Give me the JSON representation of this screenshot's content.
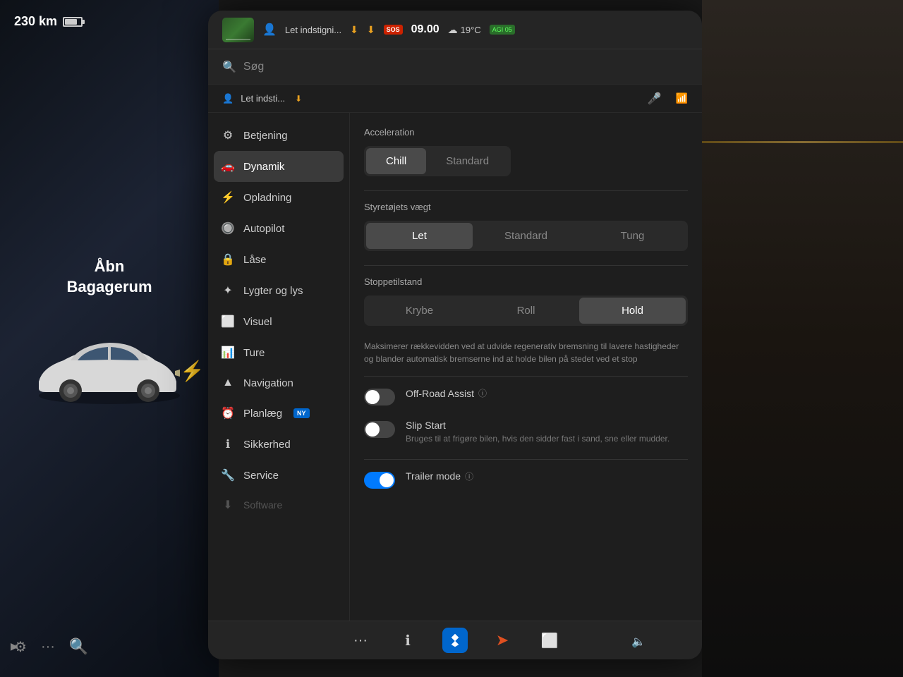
{
  "km_display": {
    "value": "230 km"
  },
  "status_bar": {
    "person_label": "Let indstigni...",
    "time": "09.00",
    "temperature": "19°C",
    "sos_label": "SOS",
    "aqi_label": "AGI 05"
  },
  "secondary_bar": {
    "person_label": "Let indsti...",
    "arrow_label": "▼",
    "mic_label": "🎤"
  },
  "search": {
    "placeholder": "Søg"
  },
  "sidebar": {
    "items": [
      {
        "id": "betjening",
        "label": "Betjening",
        "icon": "⚙"
      },
      {
        "id": "dynamik",
        "label": "Dynamik",
        "icon": "🚗",
        "active": true
      },
      {
        "id": "opladning",
        "label": "Opladning",
        "icon": "⚡"
      },
      {
        "id": "autopilot",
        "label": "Autopilot",
        "icon": "🔘"
      },
      {
        "id": "laase",
        "label": "Låse",
        "icon": "🔒"
      },
      {
        "id": "lygter",
        "label": "Lygter og lys",
        "icon": "✦"
      },
      {
        "id": "visuel",
        "label": "Visuel",
        "icon": "⬜"
      },
      {
        "id": "ture",
        "label": "Ture",
        "icon": "📊"
      },
      {
        "id": "navigation",
        "label": "Navigation",
        "icon": "▲"
      },
      {
        "id": "planlaeg",
        "label": "Planlæg",
        "icon": "⏰",
        "badge": "NY"
      },
      {
        "id": "sikkerhed",
        "label": "Sikkerhed",
        "icon": "ℹ"
      },
      {
        "id": "service",
        "label": "Service",
        "icon": "🔧"
      },
      {
        "id": "software",
        "label": "Software",
        "icon": "⬇"
      }
    ]
  },
  "settings": {
    "acceleration": {
      "label": "Acceleration",
      "options": [
        {
          "id": "chill",
          "label": "Chill",
          "active": true
        },
        {
          "id": "standard",
          "label": "Standard",
          "active": false
        }
      ]
    },
    "steering_weight": {
      "label": "Styretøjets vægt",
      "options": [
        {
          "id": "let",
          "label": "Let",
          "active": true
        },
        {
          "id": "standard",
          "label": "Standard",
          "active": false
        },
        {
          "id": "tung",
          "label": "Tung",
          "active": false
        }
      ]
    },
    "stop_mode": {
      "label": "Stoppetilstand",
      "options": [
        {
          "id": "krybe",
          "label": "Krybe",
          "active": false
        },
        {
          "id": "roll",
          "label": "Roll",
          "active": false
        },
        {
          "id": "hold",
          "label": "Hold",
          "active": true
        }
      ],
      "description": "Maksimerer rækkevidden ved at udvide regenerativ bremsning til lavere hastigheder og blander automatisk bremserne ind at holde bilen på stedet ved et stop"
    },
    "off_road": {
      "title": "Off-Road Assist",
      "state": "off"
    },
    "slip_start": {
      "title": "Slip Start",
      "description": "Bruges til at frigøre bilen, hvis den sidder fast i sand, sne eller mudder.",
      "state": "off"
    },
    "trailer_mode": {
      "title": "Trailer mode",
      "state": "on"
    }
  },
  "taskbar": {
    "items": [
      {
        "id": "more",
        "label": "···"
      },
      {
        "id": "info",
        "label": "ℹ"
      },
      {
        "id": "bluetooth",
        "label": "B"
      },
      {
        "id": "nav",
        "label": "➤"
      },
      {
        "id": "apps",
        "label": "⬜"
      }
    ]
  },
  "car": {
    "open_trunk_label": "Åbn",
    "trunk_label": "Bagagerum"
  }
}
